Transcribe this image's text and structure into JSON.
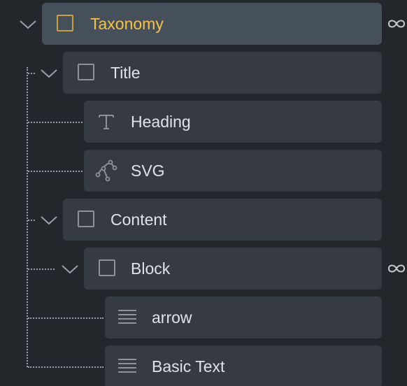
{
  "tree": {
    "root": {
      "label": "Taxonomy",
      "icon": "container-box-icon",
      "selected": true,
      "linked": true
    },
    "items": [
      {
        "label": "Title",
        "icon": "container-box-icon"
      },
      {
        "label": "Heading",
        "icon": "text-icon"
      },
      {
        "label": "SVG",
        "icon": "vector-pen-icon"
      },
      {
        "label": "Content",
        "icon": "container-box-icon"
      },
      {
        "label": "Block",
        "icon": "container-box-icon",
        "linked": true
      },
      {
        "label": "arrow",
        "icon": "lines-icon"
      },
      {
        "label": "Basic Text",
        "icon": "lines-icon"
      }
    ]
  },
  "colors": {
    "background": "#23262a",
    "row": "#363b42",
    "row_selected": "#46505b",
    "accent": "#f5c244",
    "text": "#dfe3e8",
    "icon": "#8c939b"
  }
}
